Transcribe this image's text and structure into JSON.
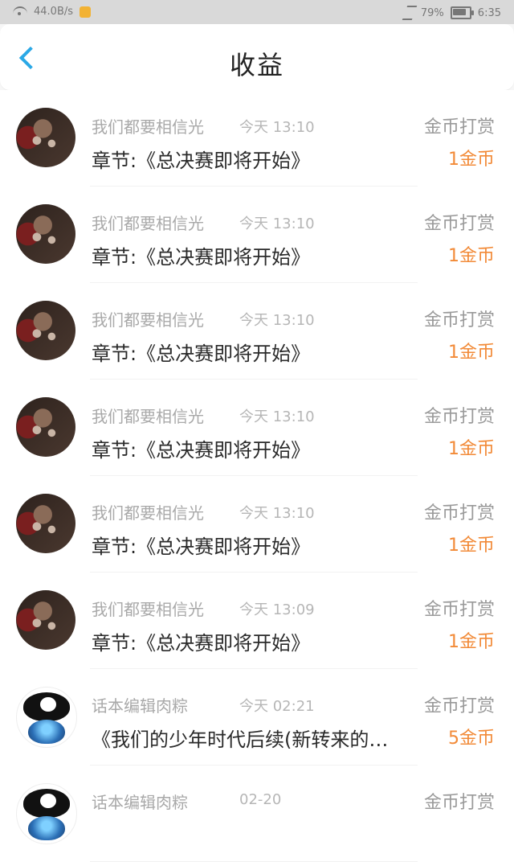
{
  "status_bar": {
    "speed": "44.0B/s",
    "battery": "79%",
    "battery_level": 0.79,
    "time": "6:35",
    "icons": [
      "wifi-icon",
      "app-icon",
      "bluetooth-icon",
      "battery-icon"
    ]
  },
  "header": {
    "title": "收益",
    "back_icon": "back-chevron-icon",
    "accent": "#2aa8e6"
  },
  "colors": {
    "amount": "#f28a37",
    "muted": "#a9a9a9",
    "text": "#2a2a2a"
  },
  "items": [
    {
      "sender": "我们都要相信光",
      "time": "今天 13:10",
      "type": "金币打赏",
      "content": "章节:《总决赛即将开始》",
      "amount": "1金币",
      "avatar": "dark"
    },
    {
      "sender": "我们都要相信光",
      "time": "今天 13:10",
      "type": "金币打赏",
      "content": "章节:《总决赛即将开始》",
      "amount": "1金币",
      "avatar": "dark"
    },
    {
      "sender": "我们都要相信光",
      "time": "今天 13:10",
      "type": "金币打赏",
      "content": "章节:《总决赛即将开始》",
      "amount": "1金币",
      "avatar": "dark"
    },
    {
      "sender": "我们都要相信光",
      "time": "今天 13:10",
      "type": "金币打赏",
      "content": "章节:《总决赛即将开始》",
      "amount": "1金币",
      "avatar": "dark"
    },
    {
      "sender": "我们都要相信光",
      "time": "今天 13:10",
      "type": "金币打赏",
      "content": "章节:《总决赛即将开始》",
      "amount": "1金币",
      "avatar": "dark"
    },
    {
      "sender": "我们都要相信光",
      "time": "今天 13:09",
      "type": "金币打赏",
      "content": "章节:《总决赛即将开始》",
      "amount": "1金币",
      "avatar": "dark"
    },
    {
      "sender": "话本编辑肉粽",
      "time": "今天 02:21",
      "type": "金币打赏",
      "content": "《我们的少年时代后续(新转来的…",
      "amount": "5金币",
      "avatar": "cartoon"
    },
    {
      "sender": "话本编辑肉粽",
      "time": "02-20",
      "type": "金币打赏",
      "content": "",
      "amount": "",
      "avatar": "cartoon"
    }
  ]
}
